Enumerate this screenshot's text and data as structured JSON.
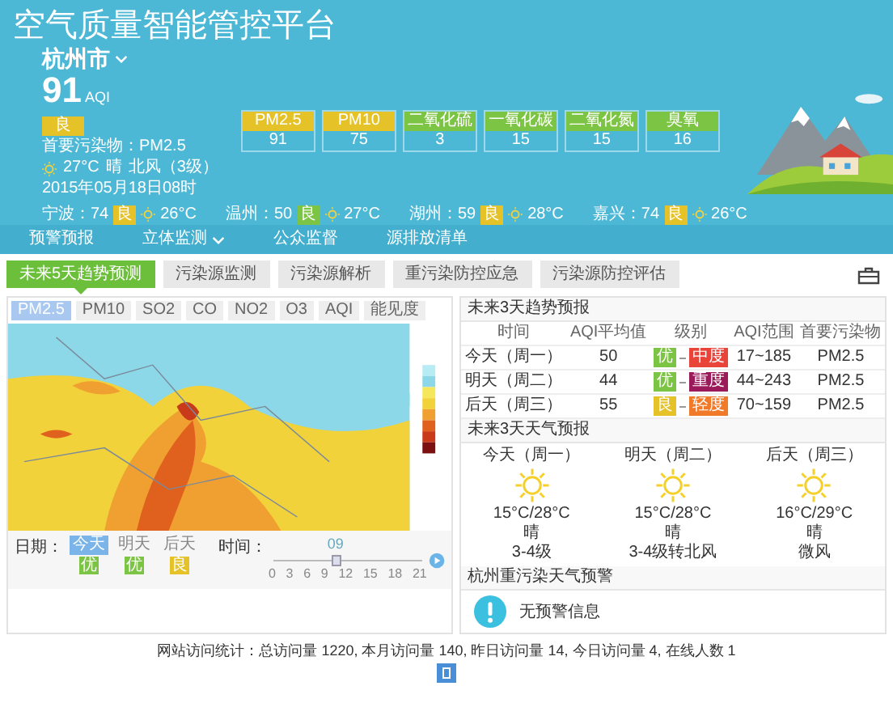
{
  "header": {
    "title": "空气质量智能管控平台",
    "city": "杭州市",
    "aqi": "91",
    "aqi_unit": "AQI",
    "grade": {
      "label": "良",
      "color": "#e6c229"
    },
    "primary_pollutant": "首要污染物：PM2.5",
    "weather": {
      "temp": "27°C",
      "condition": "晴",
      "wind": "北风（3级）"
    },
    "time": "2015年05月18日08时",
    "pollutants": [
      {
        "name": "PM2.5",
        "value": "91",
        "color": "#e6c229"
      },
      {
        "name": "PM10",
        "value": "75",
        "color": "#e6c229"
      },
      {
        "name": "二氧化硫",
        "value": "3",
        "color": "#7cc443"
      },
      {
        "name": "一氧化碳",
        "value": "15",
        "color": "#7cc443"
      },
      {
        "name": "二氧化氮",
        "value": "15",
        "color": "#7cc443"
      },
      {
        "name": "臭氧",
        "value": "16",
        "color": "#7cc443"
      }
    ],
    "cities": [
      {
        "name": "宁波：74",
        "grade": "良",
        "color": "#e6c229",
        "temp": "26°C"
      },
      {
        "name": "温州：50",
        "grade": "良",
        "color": "#7cc443",
        "temp": "27°C"
      },
      {
        "name": "湖州：59",
        "grade": "良",
        "color": "#e6c229",
        "temp": "28°C"
      },
      {
        "name": "嘉兴：74",
        "grade": "良",
        "color": "#e6c229",
        "temp": "26°C"
      }
    ]
  },
  "nav": [
    {
      "label": "预警预报",
      "dropdown": false
    },
    {
      "label": "立体监测",
      "dropdown": true
    },
    {
      "label": "公众监督",
      "dropdown": false
    },
    {
      "label": "源排放清单",
      "dropdown": false
    }
  ],
  "modules": [
    {
      "label": "未来5天趋势预测",
      "selected": true
    },
    {
      "label": "污染源监测",
      "selected": false
    },
    {
      "label": "污染源解析",
      "selected": false
    },
    {
      "label": "重污染防控应急",
      "selected": false
    },
    {
      "label": "污染源防控评估",
      "selected": false
    }
  ],
  "pollutant_tabs": [
    {
      "label": "PM2.5",
      "selected": true
    },
    {
      "label": "PM10",
      "selected": false
    },
    {
      "label": "SO2",
      "selected": false
    },
    {
      "label": "CO",
      "selected": false
    },
    {
      "label": "NO2",
      "selected": false
    },
    {
      "label": "O3",
      "selected": false
    },
    {
      "label": "AQI",
      "selected": false
    },
    {
      "label": "能见度",
      "selected": false
    }
  ],
  "map_controls": {
    "date_label": "日期：",
    "days": [
      {
        "label": "今天",
        "selected": true,
        "grade": "优",
        "color": "#7cc443"
      },
      {
        "label": "明天",
        "selected": false,
        "grade": "优",
        "color": "#7cc443"
      },
      {
        "label": "后天",
        "selected": false,
        "grade": "良",
        "color": "#e6c229"
      }
    ],
    "time_label": "时间：",
    "time_value": "09",
    "ticks": [
      "0",
      "3",
      "6",
      "9",
      "12",
      "15",
      "18",
      "21"
    ],
    "level": 0.4286
  },
  "forecast": {
    "title": "未来3天趋势预报",
    "columns": [
      "时间",
      "AQI平均值",
      "级别",
      "AQI范围",
      "首要污染物"
    ],
    "rows": [
      {
        "day": "今天（周一）",
        "avg": "50",
        "from": {
          "label": "优",
          "color": "#7cc443"
        },
        "to": {
          "label": "中度",
          "color": "#e8443a"
        },
        "range": "17~185",
        "primary": "PM2.5"
      },
      {
        "day": "明天（周二）",
        "avg": "44",
        "from": {
          "label": "优",
          "color": "#7cc443"
        },
        "to": {
          "label": "重度",
          "color": "#9b1b5a"
        },
        "range": "44~243",
        "primary": "PM2.5"
      },
      {
        "day": "后天（周三）",
        "avg": "55",
        "from": {
          "label": "良",
          "color": "#e6c229"
        },
        "to": {
          "label": "轻度",
          "color": "#f07a2a"
        },
        "range": "70~159",
        "primary": "PM2.5"
      }
    ]
  },
  "weather": {
    "title": "未来3天天气预报",
    "days": [
      {
        "day": "今天（周一）",
        "temps": "15°C/28°C",
        "condition": "晴",
        "wind": "3-4级"
      },
      {
        "day": "明天（周二）",
        "temps": "15°C/28°C",
        "condition": "晴",
        "wind": "3-4级转北风"
      },
      {
        "day": "后天（周三）",
        "temps": "16°C/29°C",
        "condition": "晴",
        "wind": "微风"
      }
    ]
  },
  "alert": {
    "title": "杭州重污染天气预警",
    "message": "无预警信息"
  },
  "footer": "网站访问统计：总访问量 1220, 本月访问量 140, 昨日访问量 14, 今日访问量 4, 在线人数 1"
}
